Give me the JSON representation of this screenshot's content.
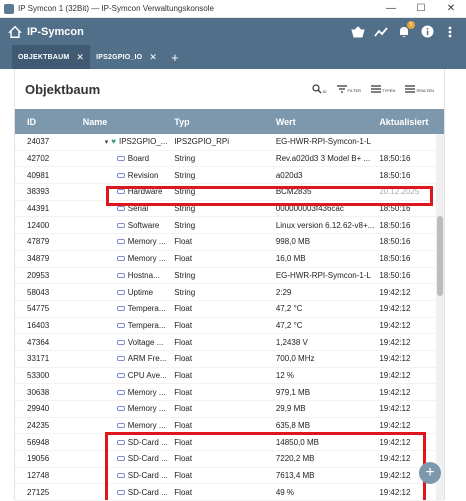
{
  "window": {
    "title": "IP Symcon 1 (32Bit) — IP-Symcon Verwaltungskonsole",
    "minimize": "—",
    "maximize": "☐",
    "close": "✕"
  },
  "app": {
    "brand": "IP-Symcon",
    "badge": "5"
  },
  "tabs": [
    {
      "label": "OBJEKTBAUM"
    },
    {
      "label": "IPS2GPIO_IO"
    }
  ],
  "tab_add": "+",
  "header": {
    "title": "Objektbaum",
    "actions": [
      {
        "label": "ID"
      },
      {
        "label": "FILTER"
      },
      {
        "label": "TYPEN"
      },
      {
        "label": "SPALTEN"
      }
    ]
  },
  "table": {
    "columns": [
      "ID",
      "Name",
      "Typ",
      "Wert",
      "Aktualisiert"
    ],
    "rows": [
      {
        "id": "24037",
        "name": "IPS2GPIO_...",
        "typ": "IPS2GPIO_RPi",
        "wert": "EG-HWR-RPI-Symcon-1-L",
        "akt": "",
        "kind": "instance"
      },
      {
        "id": "42702",
        "name": "Board",
        "typ": "String",
        "wert": "Rev.a020d3 3 Model B+ ...",
        "akt": "18:50:16",
        "kind": "var"
      },
      {
        "id": "40981",
        "name": "Revision",
        "typ": "String",
        "wert": "a020d3",
        "akt": "18:50:16",
        "kind": "var"
      },
      {
        "id": "38393",
        "name": "Hardware",
        "typ": "String",
        "wert": "BCM2835",
        "akt": "20.12.2025",
        "kind": "var",
        "muted_akt": true
      },
      {
        "id": "44391",
        "name": "Serial",
        "typ": "String",
        "wert": "000000003f436cac",
        "akt": "18:50:16",
        "kind": "var"
      },
      {
        "id": "12400",
        "name": "Software",
        "typ": "String",
        "wert": "Linux version 6.12.62-v8+...",
        "akt": "18:50:16",
        "kind": "var"
      },
      {
        "id": "47879",
        "name": "Memory ...",
        "typ": "Float",
        "wert": "998,0 MB",
        "akt": "18:50:16",
        "kind": "var"
      },
      {
        "id": "34879",
        "name": "Memory ...",
        "typ": "Float",
        "wert": "16,0 MB",
        "akt": "18:50:16",
        "kind": "var"
      },
      {
        "id": "20953",
        "name": "Hostna...",
        "typ": "String",
        "wert": "EG-HWR-RPI-Symcon-1-L",
        "akt": "18:50:16",
        "kind": "var"
      },
      {
        "id": "58043",
        "name": "Uptime",
        "typ": "String",
        "wert": "2:29",
        "akt": "19:42:12",
        "kind": "var"
      },
      {
        "id": "54775",
        "name": "Tempera...",
        "typ": "Float",
        "wert": "47,2 °C",
        "akt": "19:42:12",
        "kind": "var"
      },
      {
        "id": "16403",
        "name": "Tempera...",
        "typ": "Float",
        "wert": "47,2 °C",
        "akt": "19:42:12",
        "kind": "var"
      },
      {
        "id": "47364",
        "name": "Voltage ...",
        "typ": "Float",
        "wert": "1,2438 V",
        "akt": "19:42:12",
        "kind": "var"
      },
      {
        "id": "33171",
        "name": "ARM Fre...",
        "typ": "Float",
        "wert": "700,0 MHz",
        "akt": "19:42:12",
        "kind": "var"
      },
      {
        "id": "53300",
        "name": "CPU Ave...",
        "typ": "Float",
        "wert": "12 %",
        "akt": "19:42:12",
        "kind": "var"
      },
      {
        "id": "30638",
        "name": "Memory ...",
        "typ": "Float",
        "wert": "979,1 MB",
        "akt": "19:42:12",
        "kind": "var"
      },
      {
        "id": "29940",
        "name": "Memory ...",
        "typ": "Float",
        "wert": "29,9 MB",
        "akt": "19:42:12",
        "kind": "var"
      },
      {
        "id": "24235",
        "name": "Memory ...",
        "typ": "Float",
        "wert": "635,8 MB",
        "akt": "19:42:12",
        "kind": "var"
      },
      {
        "id": "56948",
        "name": "SD-Card ...",
        "typ": "Float",
        "wert": "14850,0 MB",
        "akt": "19:42:12",
        "kind": "var"
      },
      {
        "id": "19056",
        "name": "SD-Card ...",
        "typ": "Float",
        "wert": "7220,2 MB",
        "akt": "19:42:12",
        "kind": "var"
      },
      {
        "id": "12748",
        "name": "SD-Card ...",
        "typ": "Float",
        "wert": "7613,4 MB",
        "akt": "19:42:12",
        "kind": "var"
      },
      {
        "id": "27125",
        "name": "SD-Card ...",
        "typ": "Float",
        "wert": "49 %",
        "akt": "19:42:12",
        "kind": "var"
      }
    ]
  },
  "fab": "+",
  "colors": {
    "appbar": "#516f89",
    "table_header": "#7d98ad",
    "highlight": "#e0161d",
    "instance_icon": "#2e9e6e",
    "var_icon": "#7e8bd0"
  }
}
